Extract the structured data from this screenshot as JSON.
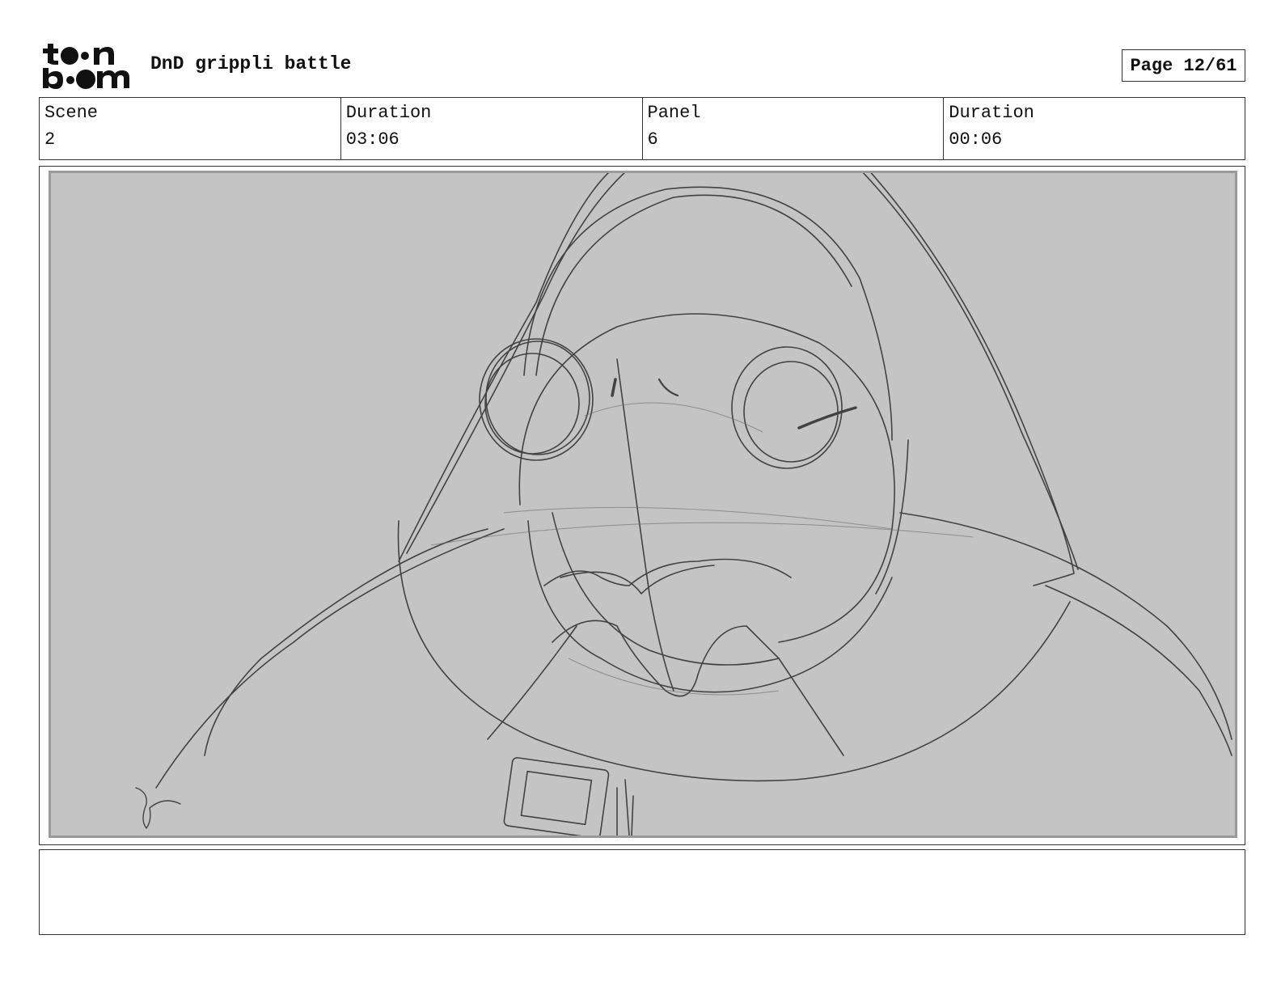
{
  "header": {
    "logo_text": "toon boom",
    "project_title": "DnD grippli battle",
    "page_indicator": "Page 12/61"
  },
  "info": {
    "scene_label": "Scene",
    "scene_value": "2",
    "scene_duration_label": "Duration",
    "scene_duration_value": "03:06",
    "panel_label": "Panel",
    "panel_value": "6",
    "panel_duration_label": "Duration",
    "panel_duration_value": "00:06"
  },
  "panel": {
    "sketch_signature": "jr"
  },
  "notes": {
    "text": ""
  }
}
